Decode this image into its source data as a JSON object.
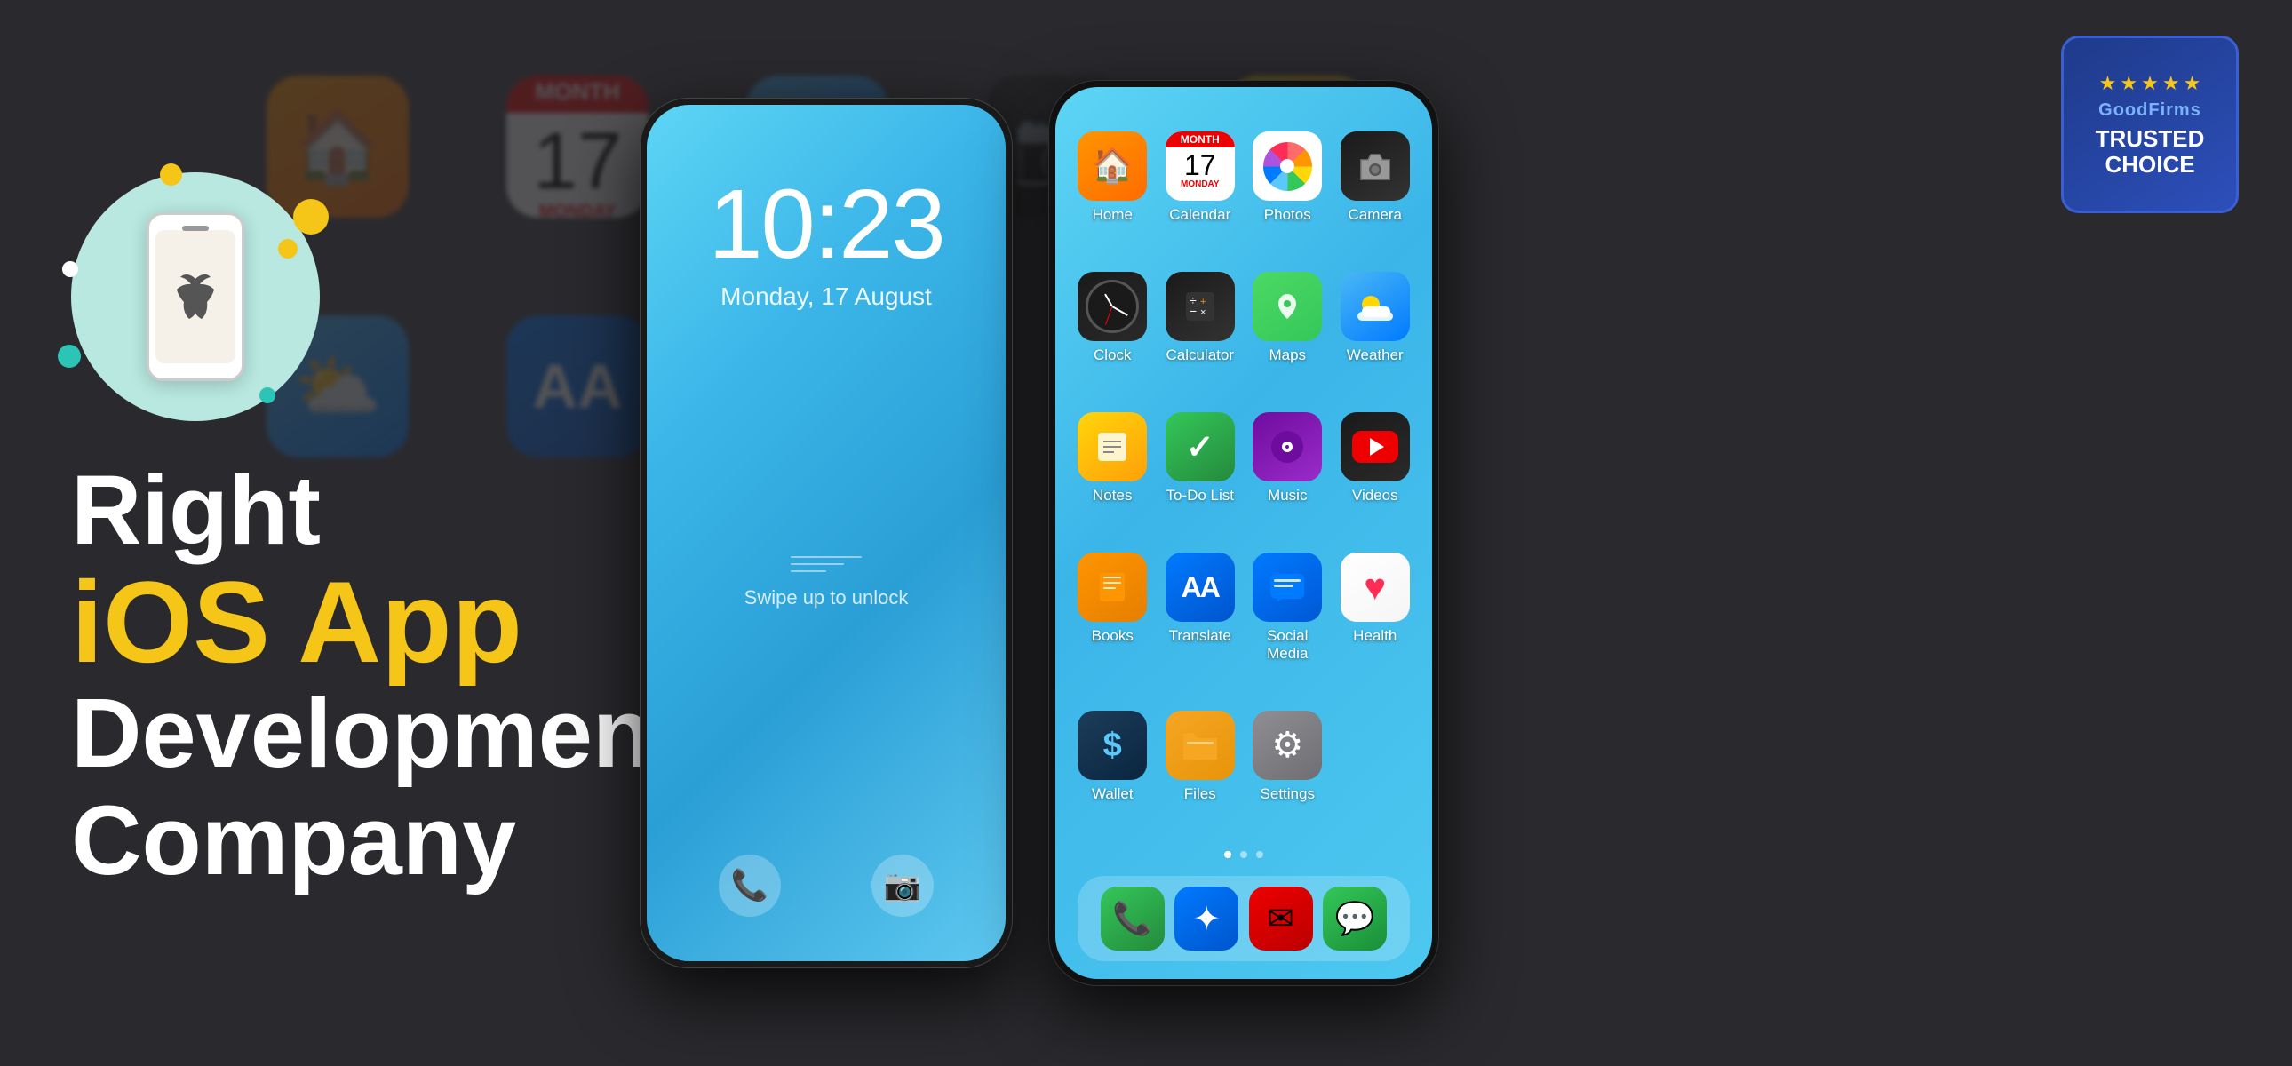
{
  "page": {
    "title": "Right iOS App Development Company",
    "background_color": "#2a2a2e"
  },
  "headline": {
    "line1": "Right",
    "line2": "iOS App",
    "line3": "Development",
    "line4": "Company"
  },
  "lock_screen": {
    "time": "10:23",
    "date": "Monday, 17 August",
    "swipe_text": "Swipe up to unlock"
  },
  "badge": {
    "stars": "★★★★",
    "brand": "GoodFirms",
    "line1": "TRUSTED",
    "line2": "CHOICE"
  },
  "apps": [
    {
      "name": "Home",
      "emoji": "🏠",
      "color_class": "icon-home"
    },
    {
      "name": "Calendar",
      "emoji": "📅",
      "color_class": "icon-calendar"
    },
    {
      "name": "Photos",
      "emoji": "📷",
      "color_class": "icon-photos"
    },
    {
      "name": "Camera",
      "emoji": "📷",
      "color_class": "icon-camera"
    },
    {
      "name": "Clock",
      "emoji": "⏰",
      "color_class": "icon-clock"
    },
    {
      "name": "Calculator",
      "emoji": "🔢",
      "color_class": "icon-calculator"
    },
    {
      "name": "Maps",
      "emoji": "🗺",
      "color_class": "icon-maps"
    },
    {
      "name": "Weather",
      "emoji": "🌤",
      "color_class": "icon-weather"
    },
    {
      "name": "Notes",
      "emoji": "📝",
      "color_class": "icon-notes"
    },
    {
      "name": "To-Do List",
      "emoji": "✅",
      "color_class": "icon-todo"
    },
    {
      "name": "Music",
      "emoji": "🎵",
      "color_class": "icon-music"
    },
    {
      "name": "Videos",
      "emoji": "▶",
      "color_class": "icon-videos"
    },
    {
      "name": "Books",
      "emoji": "📚",
      "color_class": "icon-books"
    },
    {
      "name": "Translate",
      "emoji": "AA",
      "color_class": "icon-translate"
    },
    {
      "name": "Social Media",
      "emoji": "💬",
      "color_class": "icon-social"
    },
    {
      "name": "Health",
      "emoji": "❤",
      "color_class": "icon-health"
    },
    {
      "name": "Wallet",
      "emoji": "$",
      "color_class": "icon-wallet"
    },
    {
      "name": "Files",
      "emoji": "📁",
      "color_class": "icon-files"
    },
    {
      "name": "Settings",
      "emoji": "⚙",
      "color_class": "icon-settings"
    }
  ],
  "bg_apps": [
    {
      "emoji": "🏠",
      "bg": "#ff9500"
    },
    {
      "emoji": "📅",
      "bg": "#e00"
    },
    {
      "emoji": "🌤",
      "bg": "#4ab8f5"
    },
    {
      "emoji": "📷",
      "bg": "#333"
    },
    {
      "emoji": "⏰",
      "bg": "#222"
    },
    {
      "emoji": "📝",
      "bg": "#ffd60a"
    },
    {
      "emoji": "🌤",
      "bg": "#4ab8f5"
    },
    {
      "emoji": "AA",
      "bg": "#007aff"
    },
    {
      "emoji": "💬",
      "bg": "#007aff"
    },
    {
      "emoji": "✅",
      "bg": "#34c759"
    },
    {
      "emoji": "🎵",
      "bg": "#6e0c9e"
    },
    {
      "emoji": "▶",
      "bg": "#e00"
    }
  ],
  "calendar_details": {
    "month": "MONTH",
    "day": "17",
    "day_label": "MONDAY"
  },
  "dock_apps": [
    {
      "name": "Phone",
      "emoji": "📞"
    },
    {
      "name": "Compass",
      "emoji": "✦"
    },
    {
      "name": "Mail",
      "emoji": "✉"
    },
    {
      "name": "Messages",
      "emoji": "💬"
    }
  ]
}
